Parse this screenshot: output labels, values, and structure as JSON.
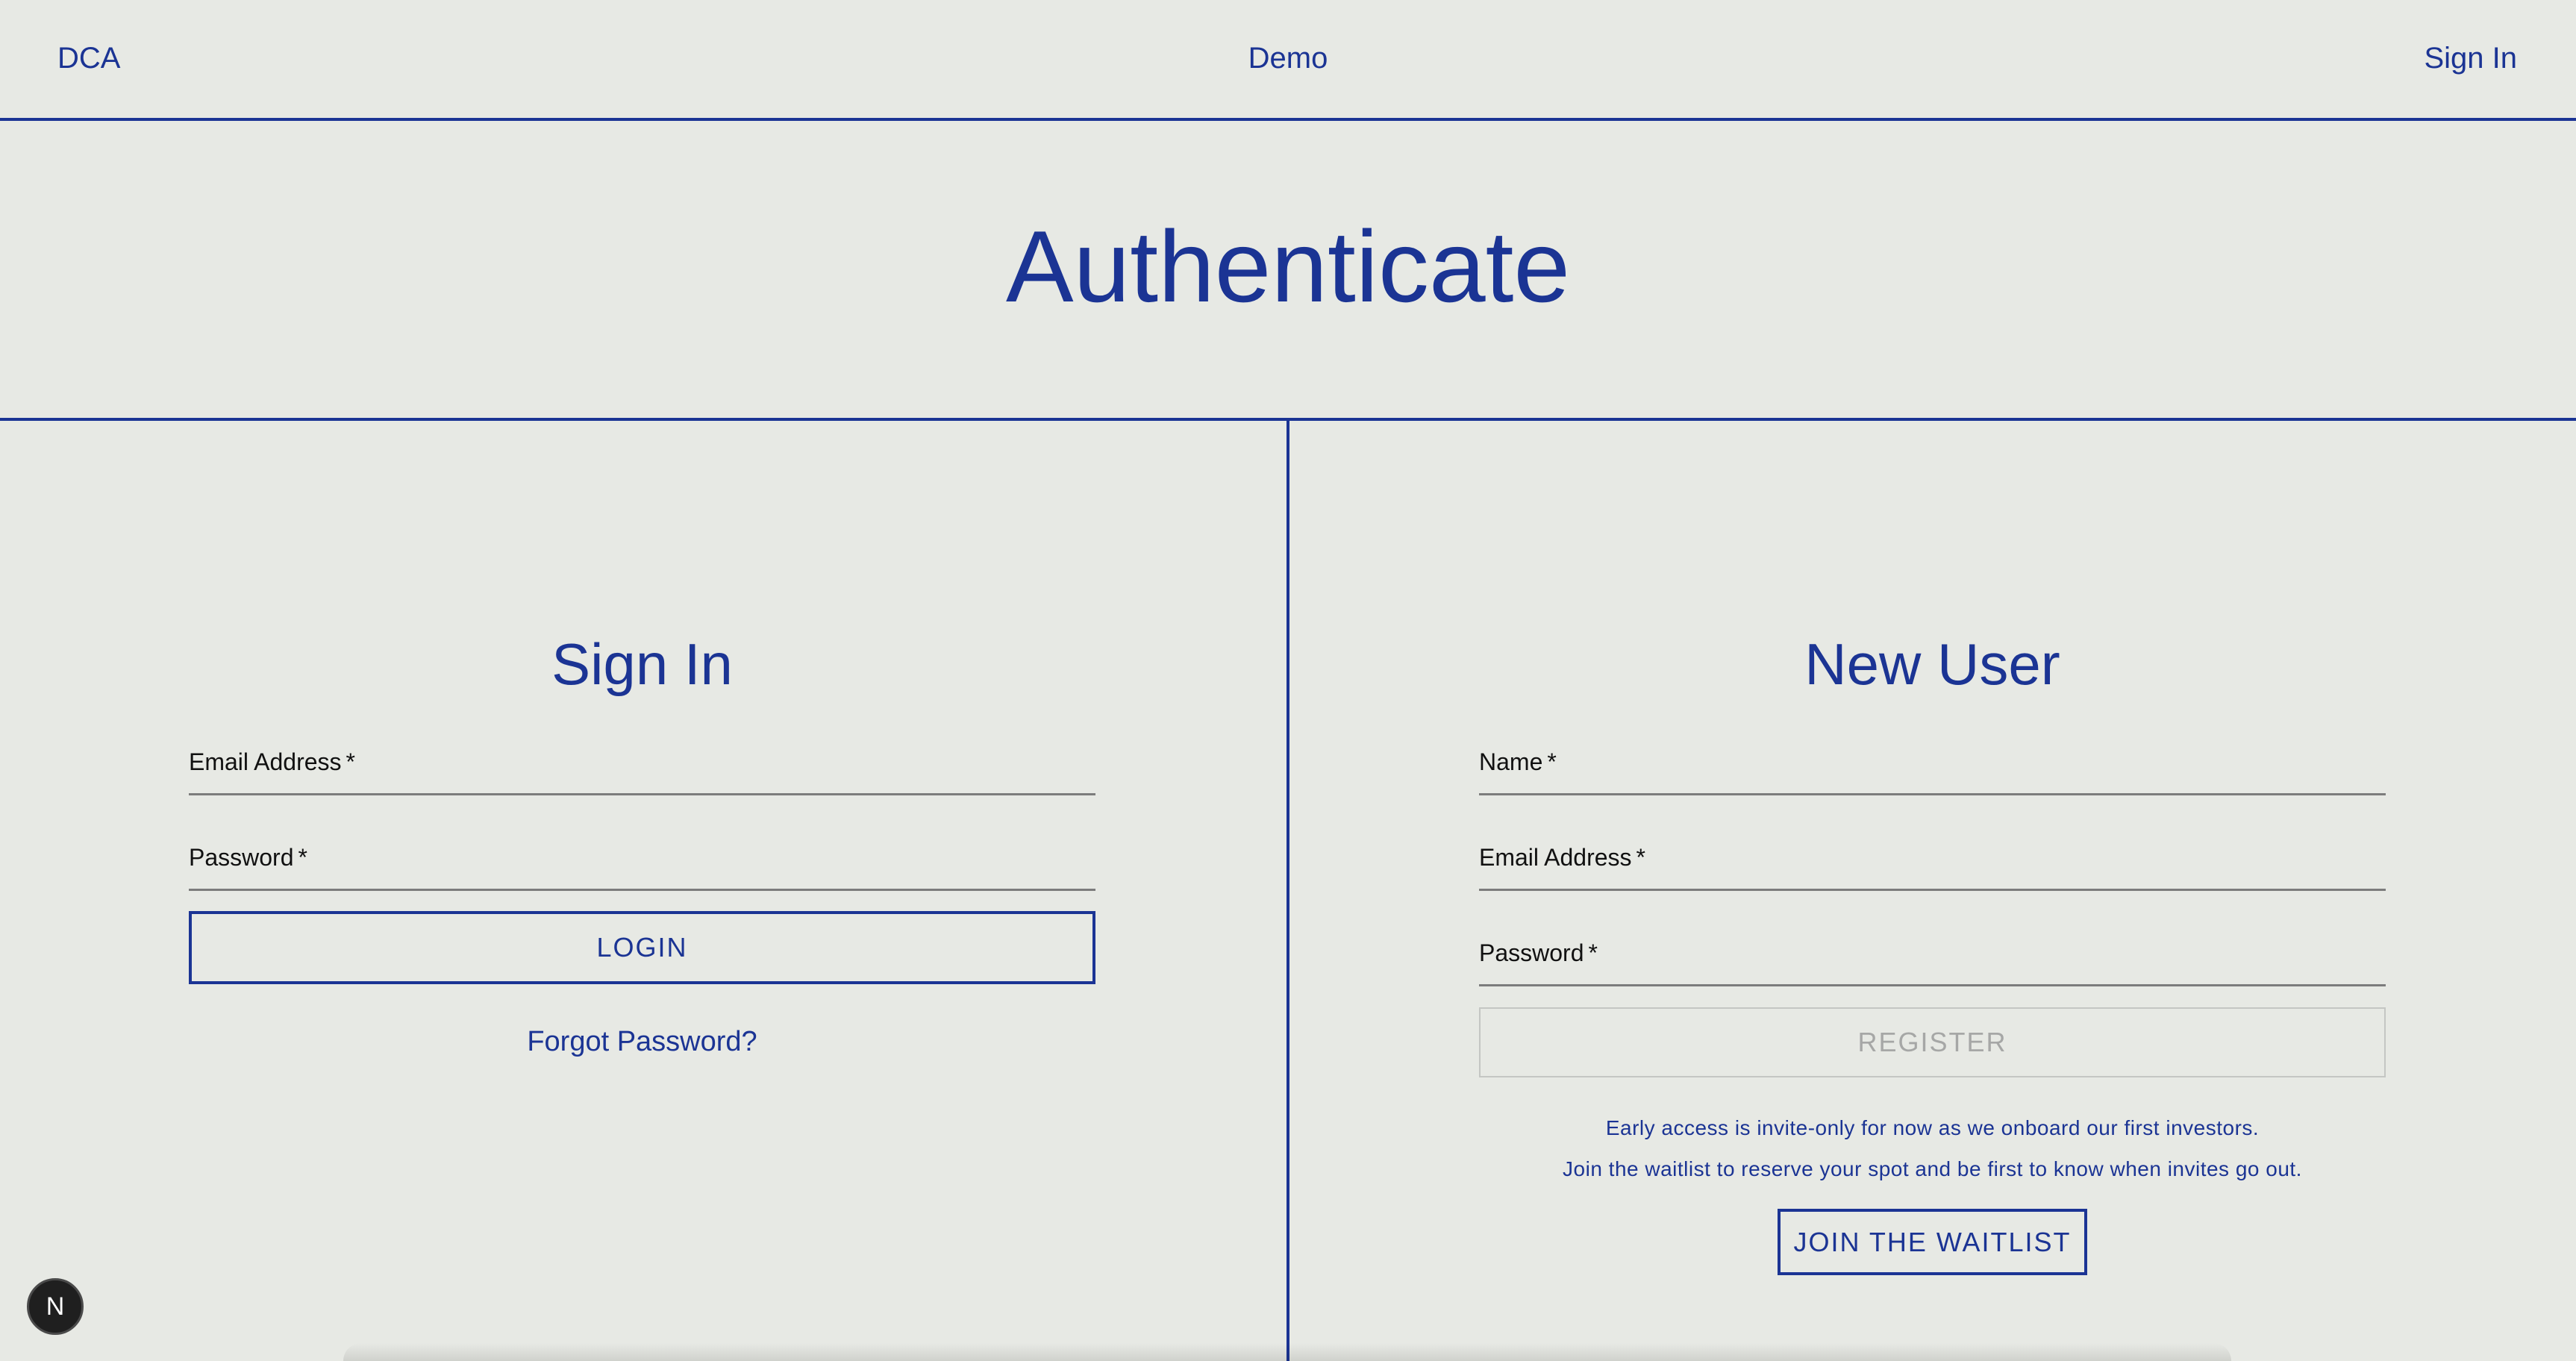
{
  "nav": {
    "brand": "DCA",
    "demo": "Demo",
    "sign_in": "Sign In"
  },
  "hero": {
    "title": "Authenticate"
  },
  "sign_in_panel": {
    "title": "Sign In",
    "email_label": "Email Address",
    "password_label": "Password",
    "required_marker": "*",
    "login_button": "LOGIN",
    "forgot_password": "Forgot Password?"
  },
  "new_user_panel": {
    "title": "New User",
    "name_label": "Name",
    "email_label": "Email Address",
    "password_label": "Password",
    "required_marker": "*",
    "register_button": "REGISTER",
    "note_line1": "Early access is invite-only for now as we onboard our first investors.",
    "note_line2": "Join the waitlist to reserve your spot and be first to know when invites go out.",
    "waitlist_button": "JOIN THE WAITLIST"
  },
  "dev_badge": {
    "label": "N"
  },
  "colors": {
    "background": "#e7e9e4",
    "accent": "#1b3494",
    "text": "#111111",
    "disabled": "#a6a7a6"
  }
}
